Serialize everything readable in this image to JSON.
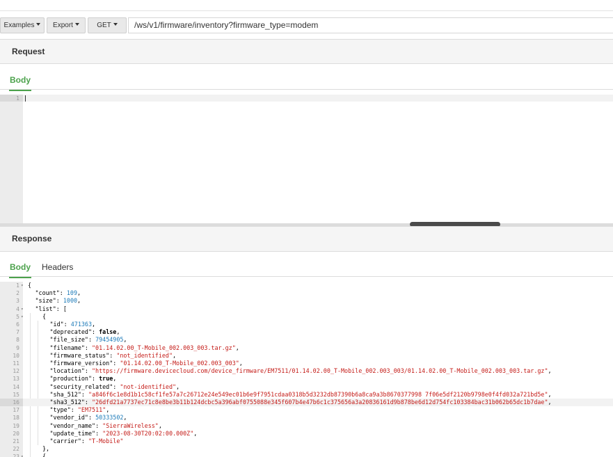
{
  "toolbar": {
    "examples_label": "Examples",
    "export_label": "Export",
    "method_label": "GET",
    "url": "/ws/v1/firmware/inventory?firmware_type=modem"
  },
  "request": {
    "title": "Request",
    "tabs": [
      "Body"
    ],
    "line_numbers": [
      "1"
    ]
  },
  "response": {
    "title": "Response",
    "tabs": [
      "Body",
      "Headers"
    ],
    "lines": [
      {
        "n": "1",
        "indent": 0,
        "fold": true,
        "parts": [
          [
            "p",
            "{"
          ]
        ]
      },
      {
        "n": "2",
        "indent": 1,
        "parts": [
          [
            "k",
            "\"count\""
          ],
          [
            "p",
            ": "
          ],
          [
            "n",
            "109"
          ],
          [
            "p",
            ","
          ]
        ]
      },
      {
        "n": "3",
        "indent": 1,
        "parts": [
          [
            "k",
            "\"size\""
          ],
          [
            "p",
            ": "
          ],
          [
            "n",
            "1000"
          ],
          [
            "p",
            ","
          ]
        ]
      },
      {
        "n": "4",
        "indent": 1,
        "fold": true,
        "parts": [
          [
            "k",
            "\"list\""
          ],
          [
            "p",
            ": ["
          ]
        ]
      },
      {
        "n": "5",
        "indent": 2,
        "fold": true,
        "parts": [
          [
            "p",
            "{"
          ]
        ]
      },
      {
        "n": "6",
        "indent": 3,
        "parts": [
          [
            "k",
            "\"id\""
          ],
          [
            "p",
            ": "
          ],
          [
            "n",
            "471363"
          ],
          [
            "p",
            ","
          ]
        ]
      },
      {
        "n": "7",
        "indent": 3,
        "parts": [
          [
            "k",
            "\"deprecated\""
          ],
          [
            "p",
            ": "
          ],
          [
            "b",
            "false"
          ],
          [
            "p",
            ","
          ]
        ]
      },
      {
        "n": "8",
        "indent": 3,
        "parts": [
          [
            "k",
            "\"file_size\""
          ],
          [
            "p",
            ": "
          ],
          [
            "n",
            "79454905"
          ],
          [
            "p",
            ","
          ]
        ]
      },
      {
        "n": "9",
        "indent": 3,
        "parts": [
          [
            "k",
            "\"filename\""
          ],
          [
            "p",
            ": "
          ],
          [
            "s",
            "\"01.14.02.00_T-Mobile_002.003_003.tar.gz\""
          ],
          [
            "p",
            ","
          ]
        ]
      },
      {
        "n": "10",
        "indent": 3,
        "parts": [
          [
            "k",
            "\"firmware_status\""
          ],
          [
            "p",
            ": "
          ],
          [
            "s",
            "\"not_identified\""
          ],
          [
            "p",
            ","
          ]
        ]
      },
      {
        "n": "11",
        "indent": 3,
        "parts": [
          [
            "k",
            "\"firmware_version\""
          ],
          [
            "p",
            ": "
          ],
          [
            "s",
            "\"01.14.02.00_T-Mobile_002.003_003\""
          ],
          [
            "p",
            ","
          ]
        ]
      },
      {
        "n": "12",
        "indent": 3,
        "parts": [
          [
            "k",
            "\"location\""
          ],
          [
            "p",
            ": "
          ],
          [
            "s",
            "\"https://firmware.devicecloud.com/device_firmware/EM7511/01.14.02.00_T-Mobile_002.003_003/01.14.02.00_T-Mobile_002.003_003.tar.gz\""
          ],
          [
            "p",
            ","
          ]
        ]
      },
      {
        "n": "13",
        "indent": 3,
        "parts": [
          [
            "k",
            "\"production\""
          ],
          [
            "p",
            ": "
          ],
          [
            "b",
            "true"
          ],
          [
            "p",
            ","
          ]
        ]
      },
      {
        "n": "14",
        "indent": 3,
        "parts": [
          [
            "k",
            "\"security_related\""
          ],
          [
            "p",
            ": "
          ],
          [
            "s",
            "\"not-identified\""
          ],
          [
            "p",
            ","
          ]
        ]
      },
      {
        "n": "15",
        "indent": 3,
        "parts": [
          [
            "k",
            "\"sha_512\""
          ],
          [
            "p",
            ": "
          ],
          [
            "s",
            "\"a846f6c1e8d1b1c58cf1fe57a7c26712e24e549ec01b6e9f7951cdaa0318b5d3232db87390b6a8ca9a3b8670377998 7f06e5df2120b9798e0f4fd032a721bd5e\""
          ],
          [
            "p",
            ","
          ]
        ]
      },
      {
        "n": "16",
        "indent": 3,
        "active": true,
        "parts": [
          [
            "k",
            "\"sha3_512\""
          ],
          [
            "p",
            ": "
          ],
          [
            "s",
            "\"26dfd21a7737ec71c8e8be3b11b124dcbc5a396abf0755088e345f607b4e47b6c1c375656a3a20836161d9b878be6d12d754fc103384bac31b062b65dc1b7dae\""
          ],
          [
            "p",
            ","
          ]
        ]
      },
      {
        "n": "17",
        "indent": 3,
        "parts": [
          [
            "k",
            "\"type\""
          ],
          [
            "p",
            ": "
          ],
          [
            "s",
            "\"EM7511\""
          ],
          [
            "p",
            ","
          ]
        ]
      },
      {
        "n": "18",
        "indent": 3,
        "parts": [
          [
            "k",
            "\"vendor_id\""
          ],
          [
            "p",
            ": "
          ],
          [
            "n",
            "50333502"
          ],
          [
            "p",
            ","
          ]
        ]
      },
      {
        "n": "19",
        "indent": 3,
        "parts": [
          [
            "k",
            "\"vendor_name\""
          ],
          [
            "p",
            ": "
          ],
          [
            "s",
            "\"SierraWireless\""
          ],
          [
            "p",
            ","
          ]
        ]
      },
      {
        "n": "20",
        "indent": 3,
        "parts": [
          [
            "k",
            "\"update_time\""
          ],
          [
            "p",
            ": "
          ],
          [
            "s",
            "\"2023-08-30T20:02:00.000Z\""
          ],
          [
            "p",
            ","
          ]
        ]
      },
      {
        "n": "21",
        "indent": 3,
        "parts": [
          [
            "k",
            "\"carrier\""
          ],
          [
            "p",
            ": "
          ],
          [
            "s",
            "\"T-Mobile\""
          ]
        ]
      },
      {
        "n": "22",
        "indent": 2,
        "parts": [
          [
            "p",
            "},"
          ]
        ]
      },
      {
        "n": "23",
        "indent": 2,
        "fold": true,
        "parts": [
          [
            "p",
            "{"
          ]
        ]
      }
    ]
  },
  "colors": {
    "accent": "#4ca24c",
    "string": "#c41a16",
    "number": "#1c7ab8"
  }
}
